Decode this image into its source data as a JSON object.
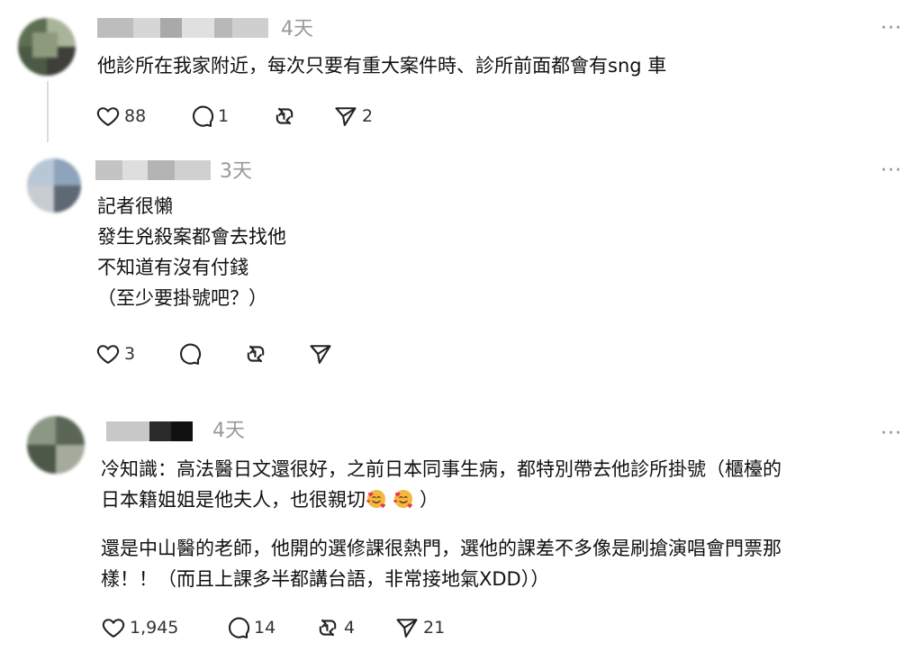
{
  "posts": [
    {
      "time": "4天",
      "lines": [
        "他診所在我家附近，每次只要有重大案件時、診所前面都會有sng 車"
      ],
      "likes": "88",
      "replies": "1",
      "reposts": "",
      "shares": "2"
    },
    {
      "time": "3天",
      "lines": [
        "記者很懶",
        "發生兇殺案都會去找他",
        "不知道有沒有付錢",
        "（至少要掛號吧？）"
      ],
      "likes": "3",
      "replies": "",
      "reposts": "",
      "shares": ""
    },
    {
      "time": "4天",
      "para1_line1": "冷知識：高法醫日文還很好，之前日本同事生病，都特別帶去他診所掛號（櫃檯的",
      "para1_line2": "日本籍姐姐是他夫人，也很親切",
      "para1_line2_end": "）",
      "para2_line1": "還是中山醫的老師，他開的選修課很熱門，選他的課差不多像是刷搶演唱會門票那",
      "para2_line2": "樣！！（而且上課多半都講台語，非常接地氣XDD））",
      "likes": "1,945",
      "replies": "14",
      "reposts": "4",
      "shares": "21"
    }
  ],
  "more_label": "···",
  "icons": {
    "like": "heart-icon",
    "reply": "comment-icon",
    "repost": "repost-icon",
    "share": "send-icon",
    "emoji": "smiling-face-with-hearts-emoji"
  }
}
